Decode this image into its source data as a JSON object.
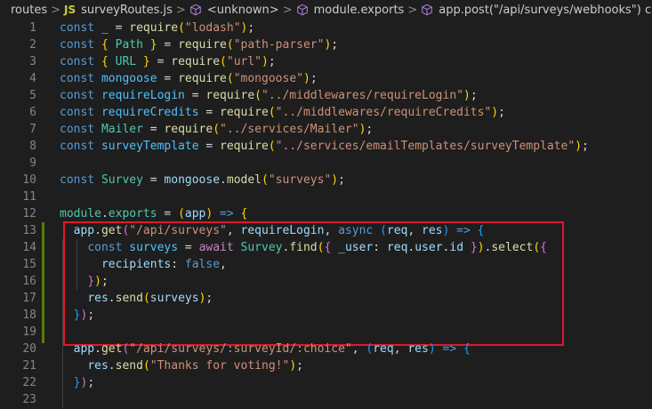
{
  "breadcrumb": {
    "items": [
      {
        "label": "routes",
        "icon": ""
      },
      {
        "label": "surveyRoutes.js",
        "icon": "JS"
      },
      {
        "label": "<unknown>",
        "icon": "cube-icon"
      },
      {
        "label": "module.exports",
        "icon": "cube-icon"
      },
      {
        "label": "app.post(\"/api/surveys/webhooks\") callback",
        "icon": "cube-icon"
      }
    ],
    "separator": ">"
  },
  "colors": {
    "background": "#1e1e1e",
    "line_numbers": "#858585",
    "highlight_box": "#e0182d",
    "gutter_modified": "#587c0c"
  },
  "editor": {
    "lines": [
      {
        "num": "1"
      },
      {
        "num": "2"
      },
      {
        "num": "3"
      },
      {
        "num": "4"
      },
      {
        "num": "5"
      },
      {
        "num": "6"
      },
      {
        "num": "7"
      },
      {
        "num": "8"
      },
      {
        "num": "9"
      },
      {
        "num": "10"
      },
      {
        "num": "11"
      },
      {
        "num": "12"
      },
      {
        "num": "13"
      },
      {
        "num": "14"
      },
      {
        "num": "15"
      },
      {
        "num": "16"
      },
      {
        "num": "17"
      },
      {
        "num": "18"
      },
      {
        "num": "19"
      },
      {
        "num": "20"
      },
      {
        "num": "21"
      },
      {
        "num": "22"
      },
      {
        "num": "23"
      }
    ],
    "tokens": {
      "const": "const",
      "underscore": "_",
      "eq": " = ",
      "require": "require",
      "lodash": "\"lodash\"",
      "path_open": "{ ",
      "Path": "Path",
      "path_close": " }",
      "path_parser": "\"path-parser\"",
      "URL": "URL",
      "url": "\"url\"",
      "mongoose": "mongoose",
      "mongoose_str": "\"mongoose\"",
      "requireLogin": "requireLogin",
      "requireLogin_str": "\"../middlewares/requireLogin\"",
      "requireCredits": "requireCredits",
      "requireCredits_str": "\"../middlewares/requireCredits\"",
      "Mailer": "Mailer",
      "Mailer_str": "\"../services/Mailer\"",
      "surveyTemplate": "surveyTemplate",
      "surveyTemplate_str": "\"../services/emailTemplates/surveyTemplate\"",
      "Survey": "Survey",
      "model": "model",
      "surveys_str": "\"surveys\"",
      "module": "module",
      "exports": "exports",
      "app": "app",
      "arrow": "=>",
      "get": "get",
      "api_surveys": "\"/api/surveys\"",
      "async": "async",
      "req": "req",
      "res": "res",
      "surveys": "surveys",
      "await": "await",
      "find": "find",
      "_user": "_user",
      "user": "user",
      "id": "id",
      "select": "select",
      "recipients": "recipients",
      "false": "false",
      "send": "send",
      "choice_route": "\"/api/surveys/:surveyId/:choice\"",
      "thanks": "\"Thanks for voting!\""
    }
  }
}
